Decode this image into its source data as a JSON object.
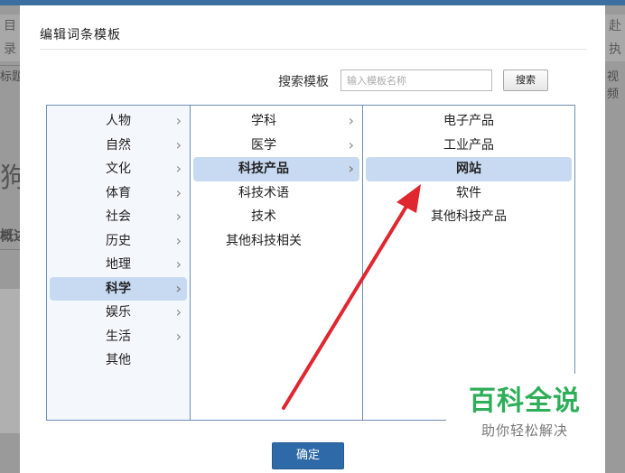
{
  "background": {
    "left_strip_text": [
      "目",
      "录"
    ],
    "right_strip_text": [
      "赴",
      "执"
    ],
    "left_label_1": "标题",
    "left_label_2": "狗",
    "left_label_3": "概述",
    "right_label_1": "视频"
  },
  "dialog": {
    "title": "编辑词条模板",
    "search": {
      "label": "搜索模板",
      "placeholder": "输入模板名称",
      "button_label": "搜索"
    },
    "columns": [
      {
        "items": [
          {
            "label": "人物",
            "has_children": true,
            "selected": false
          },
          {
            "label": "自然",
            "has_children": true,
            "selected": false
          },
          {
            "label": "文化",
            "has_children": true,
            "selected": false
          },
          {
            "label": "体育",
            "has_children": true,
            "selected": false
          },
          {
            "label": "社会",
            "has_children": true,
            "selected": false
          },
          {
            "label": "历史",
            "has_children": true,
            "selected": false
          },
          {
            "label": "地理",
            "has_children": true,
            "selected": false
          },
          {
            "label": "科学",
            "has_children": true,
            "selected": true
          },
          {
            "label": "娱乐",
            "has_children": true,
            "selected": false
          },
          {
            "label": "生活",
            "has_children": true,
            "selected": false
          },
          {
            "label": "其他",
            "has_children": false,
            "selected": false
          }
        ]
      },
      {
        "items": [
          {
            "label": "学科",
            "has_children": true,
            "selected": false
          },
          {
            "label": "医学",
            "has_children": true,
            "selected": false
          },
          {
            "label": "科技产品",
            "has_children": true,
            "selected": true
          },
          {
            "label": "科技术语",
            "has_children": false,
            "selected": false
          },
          {
            "label": "技术",
            "has_children": false,
            "selected": false
          },
          {
            "label": "其他科技相关",
            "has_children": false,
            "selected": false
          }
        ]
      },
      {
        "items": [
          {
            "label": "电子产品",
            "has_children": false,
            "selected": false
          },
          {
            "label": "工业产品",
            "has_children": false,
            "selected": false
          },
          {
            "label": "网站",
            "has_children": false,
            "selected": true
          },
          {
            "label": "软件",
            "has_children": false,
            "selected": false
          },
          {
            "label": "其他科技产品",
            "has_children": false,
            "selected": false
          }
        ]
      }
    ],
    "confirm_label": "确定"
  },
  "watermark": {
    "title": "百科全说",
    "subtitle": "助你轻松解决"
  },
  "colors": {
    "accent": "#2f6aa8",
    "selection": "#c8daf2",
    "arrow": "#e0262f",
    "watermark_green": "#2fae5a"
  },
  "icons": {
    "chevron": "›"
  }
}
